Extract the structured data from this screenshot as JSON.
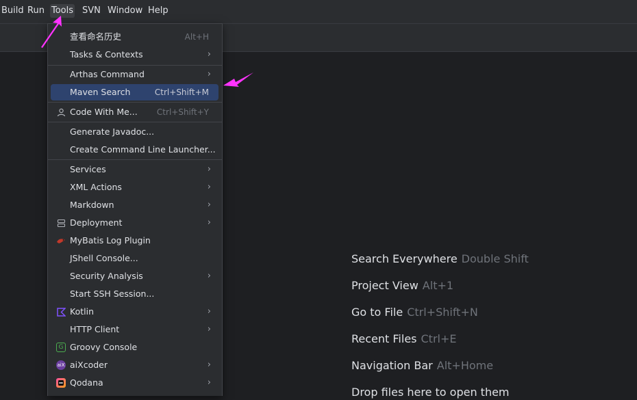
{
  "menubar": {
    "build": "Build",
    "run": "Run",
    "tools": "Tools",
    "svn": "SVN",
    "window": "Window",
    "help": "Help"
  },
  "tools_menu": {
    "history": {
      "label": "查看命名历史",
      "shortcut": "Alt+H"
    },
    "tasks": {
      "label": "Tasks & Contexts"
    },
    "arthas": {
      "label": "Arthas Command"
    },
    "maven": {
      "label": "Maven Search",
      "shortcut": "Ctrl+Shift+M"
    },
    "code_with_me": {
      "label": "Code With Me...",
      "shortcut": "Ctrl+Shift+Y"
    },
    "javadoc": {
      "label": "Generate Javadoc..."
    },
    "launcher": {
      "label": "Create Command Line Launcher..."
    },
    "services": {
      "label": "Services"
    },
    "xml": {
      "label": "XML Actions"
    },
    "markdown": {
      "label": "Markdown"
    },
    "deployment": {
      "label": "Deployment"
    },
    "mybatis": {
      "label": "MyBatis Log Plugin"
    },
    "jshell": {
      "label": "JShell Console..."
    },
    "security": {
      "label": "Security Analysis"
    },
    "ssh": {
      "label": "Start SSH Session..."
    },
    "kotlin": {
      "label": "Kotlin"
    },
    "http": {
      "label": "HTTP Client"
    },
    "groovy": {
      "label": "Groovy Console"
    },
    "aixcoder": {
      "label": "aiXcoder"
    },
    "qodana": {
      "label": "Qodana"
    }
  },
  "welcome": {
    "search": {
      "label": "Search Everywhere",
      "key": "Double Shift"
    },
    "project": {
      "label": "Project View",
      "key": "Alt+1"
    },
    "goto": {
      "label": "Go to File",
      "key": "Ctrl+Shift+N"
    },
    "recent": {
      "label": "Recent Files",
      "key": "Ctrl+E"
    },
    "navbar": {
      "label": "Navigation Bar",
      "key": "Alt+Home"
    },
    "drop": {
      "label": "Drop files here to open them"
    }
  },
  "colors": {
    "accent_highlight": "#2e436e",
    "annotation_arrow": "#ff33ff",
    "kotlin": "#7f52ff",
    "groovy": "#4caf50"
  },
  "icons": {
    "code_with_me": "person-icon",
    "deployment": "server-icon",
    "mybatis": "bird-icon",
    "kotlin": "kotlin-icon",
    "groovy": "groovy-icon",
    "aixcoder": "aixcoder-icon",
    "qodana": "qodana-icon",
    "submenu": "chevron-right-icon"
  }
}
